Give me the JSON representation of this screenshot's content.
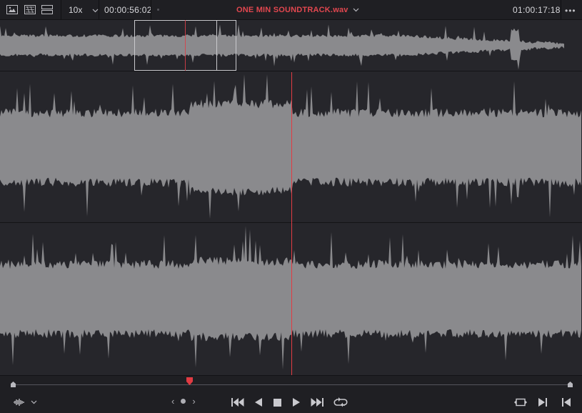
{
  "toolbar": {
    "zoom_value": "10x",
    "timecode_current": "00:00:56:02",
    "file_title": "ONE MIN SOUNDTRACK.wav",
    "timecode_end": "01:00:17:18",
    "more_label": "•••"
  },
  "transport": {
    "prev_clip": "‹",
    "next_clip": "›"
  },
  "playback": {
    "overview_position": 0.318,
    "main_position": 0.5
  },
  "colors": {
    "accent": "#e23b43",
    "waveform": "#8a8a8d",
    "background": "#26262b",
    "toolbar": "#1f1f23"
  },
  "icons": [
    "image-view-icon",
    "clip-view-icon",
    "track-view-icon",
    "chevron-down-icon",
    "more-icon",
    "jump-start-icon",
    "play-reverse-icon",
    "stop-icon",
    "play-icon",
    "jump-end-icon",
    "loop-icon",
    "match-frame-icon",
    "next-frame-icon",
    "previous-frame-icon",
    "audio-waveform-icon"
  ]
}
